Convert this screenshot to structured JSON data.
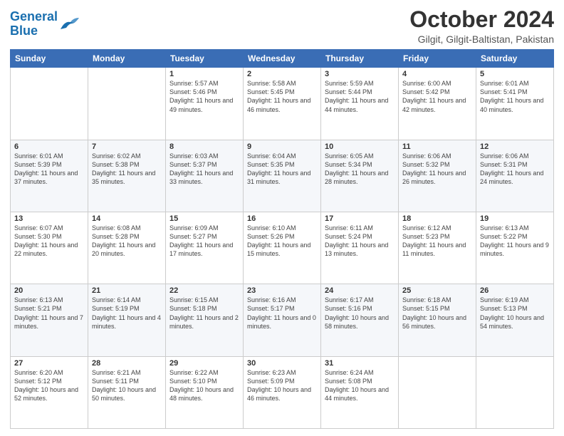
{
  "header": {
    "logo_line1": "General",
    "logo_line2": "Blue",
    "title": "October 2024",
    "subtitle": "Gilgit, Gilgit-Baltistan, Pakistan"
  },
  "weekdays": [
    "Sunday",
    "Monday",
    "Tuesday",
    "Wednesday",
    "Thursday",
    "Friday",
    "Saturday"
  ],
  "weeks": [
    [
      {
        "day": "",
        "info": ""
      },
      {
        "day": "",
        "info": ""
      },
      {
        "day": "1",
        "info": "Sunrise: 5:57 AM\nSunset: 5:46 PM\nDaylight: 11 hours and 49 minutes."
      },
      {
        "day": "2",
        "info": "Sunrise: 5:58 AM\nSunset: 5:45 PM\nDaylight: 11 hours and 46 minutes."
      },
      {
        "day": "3",
        "info": "Sunrise: 5:59 AM\nSunset: 5:44 PM\nDaylight: 11 hours and 44 minutes."
      },
      {
        "day": "4",
        "info": "Sunrise: 6:00 AM\nSunset: 5:42 PM\nDaylight: 11 hours and 42 minutes."
      },
      {
        "day": "5",
        "info": "Sunrise: 6:01 AM\nSunset: 5:41 PM\nDaylight: 11 hours and 40 minutes."
      }
    ],
    [
      {
        "day": "6",
        "info": "Sunrise: 6:01 AM\nSunset: 5:39 PM\nDaylight: 11 hours and 37 minutes."
      },
      {
        "day": "7",
        "info": "Sunrise: 6:02 AM\nSunset: 5:38 PM\nDaylight: 11 hours and 35 minutes."
      },
      {
        "day": "8",
        "info": "Sunrise: 6:03 AM\nSunset: 5:37 PM\nDaylight: 11 hours and 33 minutes."
      },
      {
        "day": "9",
        "info": "Sunrise: 6:04 AM\nSunset: 5:35 PM\nDaylight: 11 hours and 31 minutes."
      },
      {
        "day": "10",
        "info": "Sunrise: 6:05 AM\nSunset: 5:34 PM\nDaylight: 11 hours and 28 minutes."
      },
      {
        "day": "11",
        "info": "Sunrise: 6:06 AM\nSunset: 5:32 PM\nDaylight: 11 hours and 26 minutes."
      },
      {
        "day": "12",
        "info": "Sunrise: 6:06 AM\nSunset: 5:31 PM\nDaylight: 11 hours and 24 minutes."
      }
    ],
    [
      {
        "day": "13",
        "info": "Sunrise: 6:07 AM\nSunset: 5:30 PM\nDaylight: 11 hours and 22 minutes."
      },
      {
        "day": "14",
        "info": "Sunrise: 6:08 AM\nSunset: 5:28 PM\nDaylight: 11 hours and 20 minutes."
      },
      {
        "day": "15",
        "info": "Sunrise: 6:09 AM\nSunset: 5:27 PM\nDaylight: 11 hours and 17 minutes."
      },
      {
        "day": "16",
        "info": "Sunrise: 6:10 AM\nSunset: 5:26 PM\nDaylight: 11 hours and 15 minutes."
      },
      {
        "day": "17",
        "info": "Sunrise: 6:11 AM\nSunset: 5:24 PM\nDaylight: 11 hours and 13 minutes."
      },
      {
        "day": "18",
        "info": "Sunrise: 6:12 AM\nSunset: 5:23 PM\nDaylight: 11 hours and 11 minutes."
      },
      {
        "day": "19",
        "info": "Sunrise: 6:13 AM\nSunset: 5:22 PM\nDaylight: 11 hours and 9 minutes."
      }
    ],
    [
      {
        "day": "20",
        "info": "Sunrise: 6:13 AM\nSunset: 5:21 PM\nDaylight: 11 hours and 7 minutes."
      },
      {
        "day": "21",
        "info": "Sunrise: 6:14 AM\nSunset: 5:19 PM\nDaylight: 11 hours and 4 minutes."
      },
      {
        "day": "22",
        "info": "Sunrise: 6:15 AM\nSunset: 5:18 PM\nDaylight: 11 hours and 2 minutes."
      },
      {
        "day": "23",
        "info": "Sunrise: 6:16 AM\nSunset: 5:17 PM\nDaylight: 11 hours and 0 minutes."
      },
      {
        "day": "24",
        "info": "Sunrise: 6:17 AM\nSunset: 5:16 PM\nDaylight: 10 hours and 58 minutes."
      },
      {
        "day": "25",
        "info": "Sunrise: 6:18 AM\nSunset: 5:15 PM\nDaylight: 10 hours and 56 minutes."
      },
      {
        "day": "26",
        "info": "Sunrise: 6:19 AM\nSunset: 5:13 PM\nDaylight: 10 hours and 54 minutes."
      }
    ],
    [
      {
        "day": "27",
        "info": "Sunrise: 6:20 AM\nSunset: 5:12 PM\nDaylight: 10 hours and 52 minutes."
      },
      {
        "day": "28",
        "info": "Sunrise: 6:21 AM\nSunset: 5:11 PM\nDaylight: 10 hours and 50 minutes."
      },
      {
        "day": "29",
        "info": "Sunrise: 6:22 AM\nSunset: 5:10 PM\nDaylight: 10 hours and 48 minutes."
      },
      {
        "day": "30",
        "info": "Sunrise: 6:23 AM\nSunset: 5:09 PM\nDaylight: 10 hours and 46 minutes."
      },
      {
        "day": "31",
        "info": "Sunrise: 6:24 AM\nSunset: 5:08 PM\nDaylight: 10 hours and 44 minutes."
      },
      {
        "day": "",
        "info": ""
      },
      {
        "day": "",
        "info": ""
      }
    ]
  ]
}
